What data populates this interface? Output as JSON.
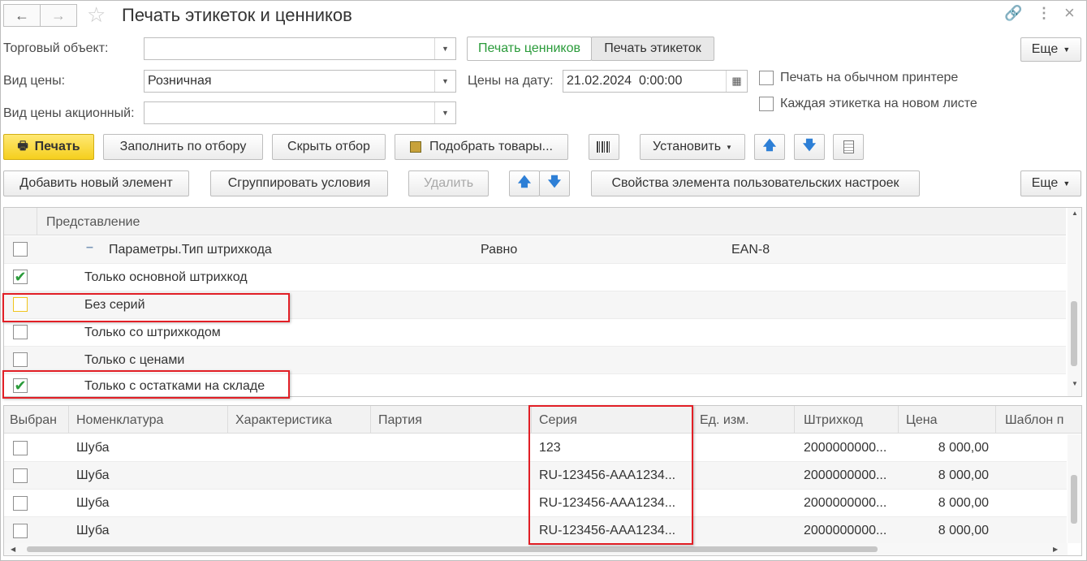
{
  "window": {
    "title": "Печать этикеток и ценников",
    "back_icon": "←",
    "forward_icon": "→",
    "star_icon": "☆",
    "link_icon": "🔗",
    "more_icon": "⋮",
    "close_icon": "×"
  },
  "form": {
    "trade_object_label": "Торговый объект:",
    "trade_object_value": "",
    "price_type_label": "Вид цены:",
    "price_type_value": "Розничная",
    "promo_price_label": "Вид цены акционный:",
    "promo_price_value": "",
    "date_label": "Цены на дату:",
    "date_value": "21.02.2024  0:00:00",
    "calendar_icon": "▦",
    "print_prices_tab": "Печать ценников",
    "print_labels_tab": "Печать этикеток",
    "more_button": "Еще",
    "ordinary_printer_label": "Печать на обычном принтере",
    "each_label_new_sheet": "Каждая этикетка на новом листе"
  },
  "toolbar1": {
    "print": "Печать",
    "fill_by_filter": "Заполнить по отбору",
    "hide_filter": "Скрыть отбор",
    "pick_goods": "Подобрать товары...",
    "set": "Установить",
    "up_icon": "🡅",
    "down_icon": "🡇"
  },
  "toolbar2": {
    "add_element": "Добавить новый элемент",
    "group_conditions": "Сгруппировать условия",
    "delete": "Удалить",
    "element_properties": "Свойства элемента пользовательских настроек",
    "more": "Еще"
  },
  "filters": {
    "header": "Представление",
    "rows": [
      {
        "label": "Параметры.Тип штрихкода",
        "condition": "Равно",
        "value": "EAN-8",
        "checked": false
      },
      {
        "label": "Только основной штрихкод",
        "condition": "",
        "value": "",
        "checked": true
      },
      {
        "label": "Без серий",
        "condition": "",
        "value": "",
        "checked": false
      },
      {
        "label": "Только со штрихкодом",
        "condition": "",
        "value": "",
        "checked": false
      },
      {
        "label": "Только с ценами",
        "condition": "",
        "value": "",
        "checked": false
      },
      {
        "label": "Только с остатками на складе",
        "condition": "",
        "value": "",
        "checked": true
      }
    ]
  },
  "goods": {
    "columns": [
      "Выбран",
      "Номенклатура",
      "Характеристика",
      "Партия",
      "Серия",
      "Ед. изм.",
      "Штрихкод",
      "Цена",
      "Шаблон п"
    ],
    "rows": [
      {
        "name": "Шуба",
        "series": "123",
        "barcode": "2000000000...",
        "price": "8 000,00"
      },
      {
        "name": "Шуба",
        "series": "RU-123456-AAA1234...",
        "barcode": "2000000000...",
        "price": "8 000,00"
      },
      {
        "name": "Шуба",
        "series": "RU-123456-AAA1234...",
        "barcode": "2000000000...",
        "price": "8 000,00"
      },
      {
        "name": "Шуба",
        "series": "RU-123456-AAA1234...",
        "barcode": "2000000000...",
        "price": "8 000,00"
      }
    ]
  },
  "colors": {
    "accent_green": "#2a9b3a",
    "highlight_red": "#e21f26",
    "print_button": "#f5cf1d"
  },
  "checkmark": "✔"
}
